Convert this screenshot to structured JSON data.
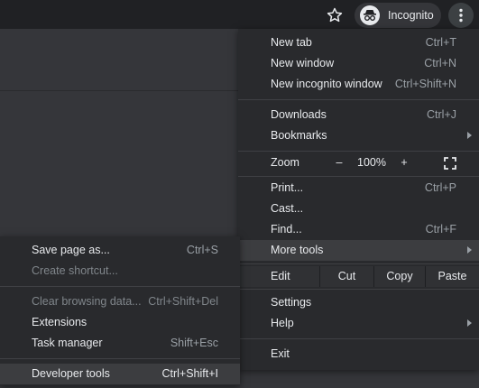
{
  "toolbar": {
    "bookmark_icon": "star-icon",
    "incognito_label": "Incognito",
    "incognito_icon": "incognito-icon",
    "menu_icon": "kebab-menu-icon"
  },
  "menu": {
    "new_tab": {
      "label": "New tab",
      "shortcut": "Ctrl+T"
    },
    "new_window": {
      "label": "New window",
      "shortcut": "Ctrl+N"
    },
    "new_incognito": {
      "label": "New incognito window",
      "shortcut": "Ctrl+Shift+N"
    },
    "downloads": {
      "label": "Downloads",
      "shortcut": "Ctrl+J"
    },
    "bookmarks": {
      "label": "Bookmarks"
    },
    "zoom": {
      "label": "Zoom",
      "minus": "–",
      "level": "100%",
      "plus": "+",
      "fullscreen_icon": "fullscreen-icon"
    },
    "print": {
      "label": "Print...",
      "shortcut": "Ctrl+P"
    },
    "cast": {
      "label": "Cast..."
    },
    "find": {
      "label": "Find...",
      "shortcut": "Ctrl+F"
    },
    "more_tools": {
      "label": "More tools"
    },
    "edit": {
      "label": "Edit",
      "cut": "Cut",
      "copy": "Copy",
      "paste": "Paste"
    },
    "settings": {
      "label": "Settings"
    },
    "help": {
      "label": "Help"
    },
    "exit": {
      "label": "Exit"
    }
  },
  "submenu": {
    "save_page": {
      "label": "Save page as...",
      "shortcut": "Ctrl+S"
    },
    "create_shortcut": {
      "label": "Create shortcut..."
    },
    "clear_data": {
      "label": "Clear browsing data...",
      "shortcut": "Ctrl+Shift+Del"
    },
    "extensions": {
      "label": "Extensions"
    },
    "task_manager": {
      "label": "Task manager",
      "shortcut": "Shift+Esc"
    },
    "developer_tools": {
      "label": "Developer tools",
      "shortcut": "Ctrl+Shift+I"
    }
  },
  "colors": {
    "menu_bg": "#292a2d",
    "highlight": "#3c3d40",
    "text": "#e8eaed",
    "shortcut_text": "#9aa0a6"
  }
}
